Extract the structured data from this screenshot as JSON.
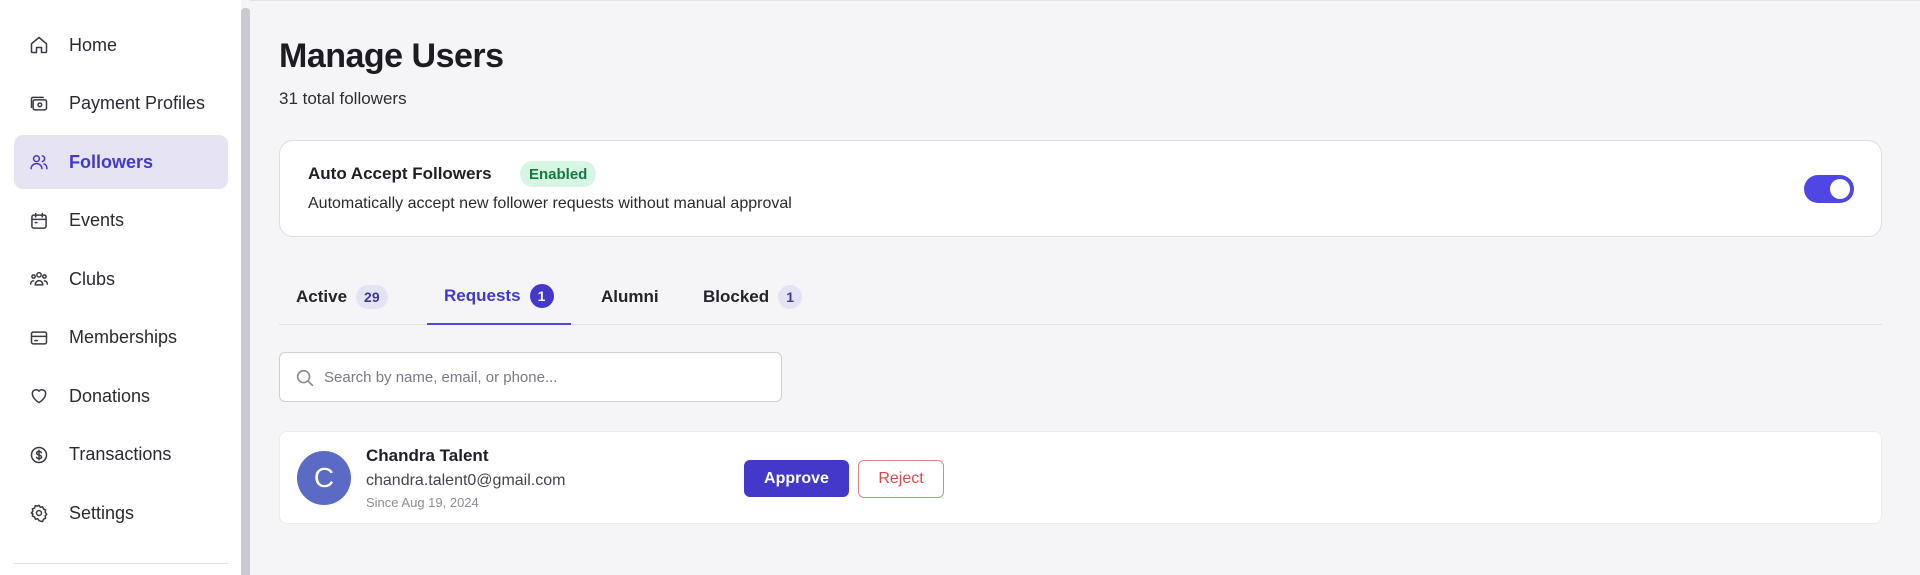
{
  "sidebar": {
    "items": [
      {
        "label": "Home",
        "icon": "home-icon",
        "active": false
      },
      {
        "label": "Payment Profiles",
        "icon": "wallet-icon",
        "active": false
      },
      {
        "label": "Followers",
        "icon": "users-icon",
        "active": true
      },
      {
        "label": "Events",
        "icon": "calendar-icon",
        "active": false
      },
      {
        "label": "Clubs",
        "icon": "group-icon",
        "active": false
      },
      {
        "label": "Memberships",
        "icon": "card-icon",
        "active": false
      },
      {
        "label": "Donations",
        "icon": "heart-icon",
        "active": false
      },
      {
        "label": "Transactions",
        "icon": "dollar-circle-icon",
        "active": false
      },
      {
        "label": "Settings",
        "icon": "gear-icon",
        "active": false
      }
    ]
  },
  "main": {
    "title": "Manage Users",
    "subtitle": "31 total followers",
    "auto_accept": {
      "title": "Auto Accept Followers",
      "badge": "Enabled",
      "description": "Automatically accept new follower requests without manual approval",
      "toggle_on": true
    },
    "tabs": [
      {
        "label": "Active",
        "count": "29",
        "active": false
      },
      {
        "label": "Requests",
        "count": "1",
        "active": true
      },
      {
        "label": "Alumni",
        "count": "",
        "active": false
      },
      {
        "label": "Blocked",
        "count": "1",
        "active": false
      }
    ],
    "search": {
      "placeholder": "Search by name, email, or phone...",
      "value": ""
    },
    "requests": [
      {
        "initial": "C",
        "name": "Chandra Talent",
        "email": "chandra.talent0@gmail.com",
        "since": "Since Aug 19, 2024",
        "approve_label": "Approve",
        "reject_label": "Reject"
      }
    ]
  },
  "colors": {
    "accent": "#4338ca",
    "toggle": "#4f46e5",
    "success_bg": "#d6f5e3",
    "success_text": "#137a43",
    "danger": "#d44a4a",
    "avatar": "#5b6ac4"
  }
}
